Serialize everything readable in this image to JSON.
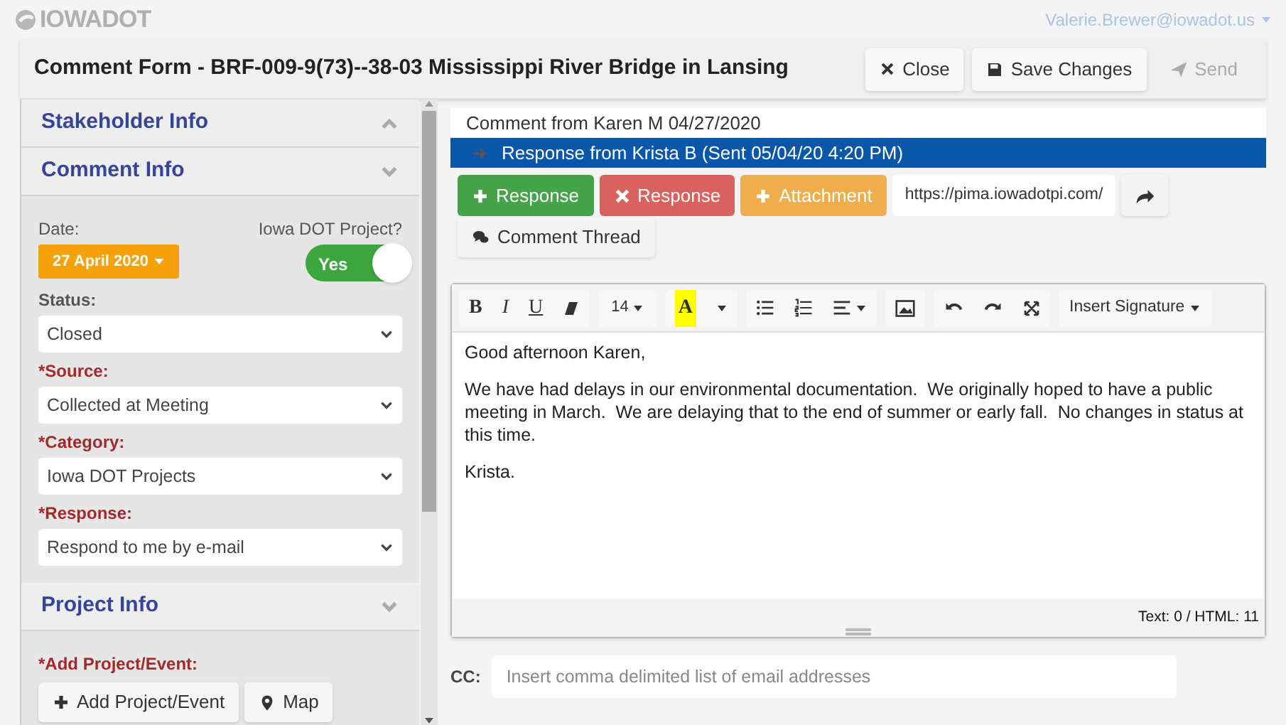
{
  "header": {
    "logo": "IOWADOT",
    "user": "Valerie.Brewer@iowadot.us"
  },
  "title": "Comment Form - BRF-009-9(73)--38-03 Mississippi River Bridge in Lansing",
  "title_buttons": [
    {
      "label": "Close",
      "disabled": false
    },
    {
      "label": "Save Changes",
      "disabled": false
    },
    {
      "label": "Send",
      "disabled": true
    }
  ],
  "sections": [
    {
      "title": "Stakeholder Info",
      "expanded": false
    },
    {
      "title": "Comment Info",
      "expanded": true
    },
    {
      "title": "Project Info",
      "expanded": true
    }
  ],
  "comment_info": {
    "date_label": "Date:",
    "date": "27 April 2020",
    "project_label": "Iowa DOT Project?",
    "project_toggle": {
      "label": "Yes",
      "on": true
    },
    "fields": [
      {
        "label": "Status:",
        "required": false,
        "value": "Closed"
      },
      {
        "label": "*Source:",
        "required": true,
        "value": "Collected at Meeting"
      },
      {
        "label": "*Category:",
        "required": true,
        "value": "Iowa DOT Projects"
      },
      {
        "label": "*Response:",
        "required": true,
        "value": "Respond to me by e-mail"
      }
    ]
  },
  "project_info": {
    "label": "*Add Project/Event:",
    "required": true,
    "buttons": [
      "Add Project/Event",
      "Map"
    ]
  },
  "thread": [
    {
      "label": "Comment from Karen M 04/27/2020",
      "selected": false
    },
    {
      "label": "Response from Krista B (Sent 05/04/20 4:20 PM)",
      "selected": true
    }
  ],
  "actions": [
    {
      "label": "Response",
      "kind": "add"
    },
    {
      "label": "Response",
      "kind": "delete"
    },
    {
      "label": "Attachment",
      "kind": "attach"
    }
  ],
  "link": "https://pima.iowadotpi.com/",
  "thread_button": "Comment Thread",
  "toolbar": {
    "bold": "B",
    "italic": "I",
    "underline": "U",
    "font_size": "14",
    "highlight": "A",
    "signature": "Insert Signature"
  },
  "editor": [
    "Good afternoon Karen,",
    "We have had delays in our environmental documentation.  We originally hoped to have a public meeting in March.  We are delaying that to the end of summer or early fall.  No changes in status at this time.",
    "Krista."
  ],
  "counter": "Text: 0 / HTML: 11",
  "cc": {
    "label": "CC:",
    "placeholder": "Insert comma delimited list of email addresses"
  }
}
